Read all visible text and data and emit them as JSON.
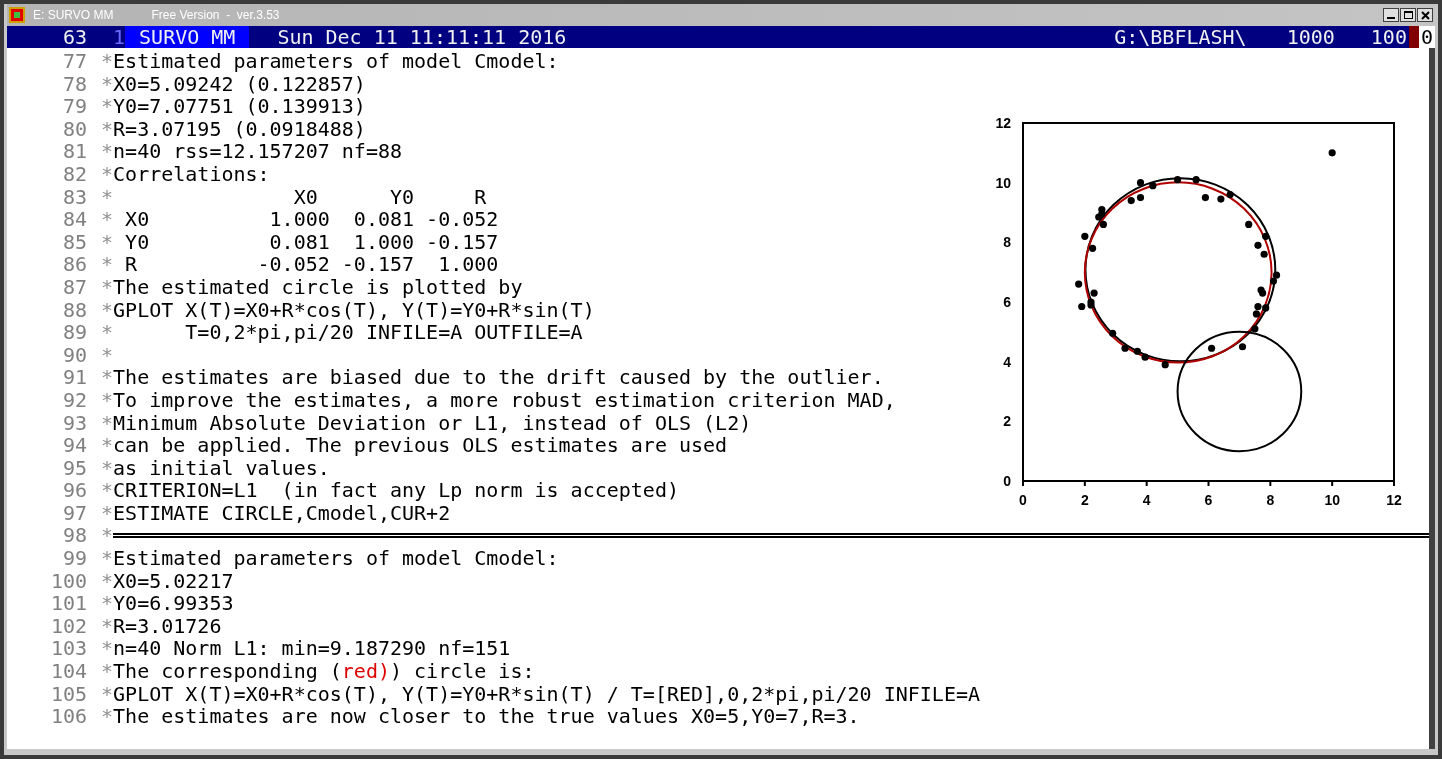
{
  "window": {
    "title": "E: SURVO MM",
    "subtitle": "Free Version  -  ver.3.53"
  },
  "status_bar": {
    "line_count": "63",
    "marker": "1",
    "program": "SURVO MM",
    "datetime": "Sun Dec 11 11:11:11 2016",
    "path": "G:\\BBFLASH\\",
    "value_1": "1000",
    "value_2": "100",
    "column": "0"
  },
  "lines": [
    {
      "num": "77",
      "ctrl": "*",
      "segments": [
        {
          "text": "Estimated parameters of model Cmodel:"
        }
      ]
    },
    {
      "num": "78",
      "ctrl": "*",
      "segments": [
        {
          "text": "X0=5.09242 (0.122857)"
        }
      ]
    },
    {
      "num": "79",
      "ctrl": "*",
      "segments": [
        {
          "text": "Y0=7.07751 (0.139913)"
        }
      ]
    },
    {
      "num": "80",
      "ctrl": "*",
      "segments": [
        {
          "text": "R=3.07195 (0.0918488)"
        }
      ]
    },
    {
      "num": "81",
      "ctrl": "*",
      "segments": [
        {
          "text": "n=40 rss=12.157207 nf=88"
        }
      ]
    },
    {
      "num": "82",
      "ctrl": "*",
      "segments": [
        {
          "text": "Correlations:"
        }
      ]
    },
    {
      "num": "83",
      "ctrl": "*",
      "segments": [
        {
          "text": "               X0      Y0     R"
        }
      ]
    },
    {
      "num": "84",
      "ctrl": "*",
      "segments": [
        {
          "text": " X0          1.000  0.081 -0.052"
        }
      ]
    },
    {
      "num": "85",
      "ctrl": "*",
      "segments": [
        {
          "text": " Y0          0.081  1.000 -0.157"
        }
      ]
    },
    {
      "num": "86",
      "ctrl": "*",
      "segments": [
        {
          "text": " R          -0.052 -0.157  1.000"
        }
      ]
    },
    {
      "num": "87",
      "ctrl": "*",
      "segments": [
        {
          "text": "The estimated circle is plotted by"
        }
      ]
    },
    {
      "num": "88",
      "ctrl": "*",
      "segments": [
        {
          "text": "GPLOT X(T)=X0+R*cos(T), Y(T)=Y0+R*sin(T)"
        }
      ]
    },
    {
      "num": "89",
      "ctrl": "*",
      "segments": [
        {
          "text": "      T=0,2*pi,pi/20 INFILE=A OUTFILE=A"
        }
      ]
    },
    {
      "num": "90",
      "ctrl": "*"
    },
    {
      "num": "91",
      "ctrl": "*",
      "segments": [
        {
          "text": "The estimates are biased due to the drift caused by the outlier."
        }
      ]
    },
    {
      "num": "92",
      "ctrl": "*",
      "segments": [
        {
          "text": "To improve the estimates, a more robust estimation criterion MAD,"
        }
      ]
    },
    {
      "num": "93",
      "ctrl": "*",
      "segments": [
        {
          "text": "Minimum Absolute Deviation or L1, instead of OLS (L2)"
        }
      ]
    },
    {
      "num": "94",
      "ctrl": "*",
      "segments": [
        {
          "text": "can be applied. The previous OLS estimates are used"
        }
      ]
    },
    {
      "num": "95",
      "ctrl": "*",
      "segments": [
        {
          "text": "as initial values."
        }
      ]
    },
    {
      "num": "96",
      "ctrl": "*",
      "segments": [
        {
          "text": "CRITERION=L1  (in fact any Lp norm is accepted)"
        }
      ]
    },
    {
      "num": "97",
      "ctrl": "*",
      "segments": [
        {
          "text": "ESTIMATE CIRCLE,Cmodel,CUR+2"
        }
      ]
    },
    {
      "num": "98",
      "ctrl": "*",
      "kind": "rule"
    },
    {
      "num": "99",
      "ctrl": "*",
      "segments": [
        {
          "text": "Estimated parameters of model Cmodel:"
        }
      ]
    },
    {
      "num": "100",
      "ctrl": "*",
      "segments": [
        {
          "text": "X0=5.02217"
        }
      ]
    },
    {
      "num": "101",
      "ctrl": "*",
      "segments": [
        {
          "text": "Y0=6.99353"
        }
      ]
    },
    {
      "num": "102",
      "ctrl": "*",
      "segments": [
        {
          "text": "R=3.01726"
        }
      ]
    },
    {
      "num": "103",
      "ctrl": "*",
      "segments": [
        {
          "text": "n=40 Norm L1: min=9.187290 nf=151"
        }
      ]
    },
    {
      "num": "104",
      "ctrl": "*",
      "segments": [
        {
          "text": "The corresponding ("
        },
        {
          "text": "red)",
          "color": "#e00000"
        },
        {
          "text": ") circle is:"
        }
      ]
    },
    {
      "num": "105",
      "ctrl": "*",
      "segments": [
        {
          "text": "GPLOT X(T)=X0+R*cos(T), Y(T)=Y0+R*sin(T) / T=[RED],0,2*pi,pi/20 INFILE=A"
        }
      ]
    },
    {
      "num": "106",
      "ctrl": "*",
      "segments": [
        {
          "text": "The estimates are now closer to the true values X0=5,Y0=7,R=3."
        }
      ]
    }
  ],
  "chart": {
    "chart_data": {
      "type": "scatter",
      "xlim": [
        0,
        12
      ],
      "ylim": [
        0,
        12
      ],
      "xticks": [
        0,
        2,
        4,
        6,
        8,
        10,
        12
      ],
      "yticks": [
        0,
        2,
        4,
        6,
        8,
        10,
        12
      ],
      "series": [
        {
          "color": "#000000",
          "x": [
            1.8,
            1.9,
            2.0,
            2.2,
            2.2,
            2.25,
            2.3,
            2.45,
            2.55,
            2.6,
            2.9,
            3.3,
            3.5,
            3.7,
            3.8,
            3.8,
            3.95,
            4.2,
            4.6,
            5.0,
            5.6,
            5.9,
            6.1,
            6.4,
            6.7,
            7.1,
            7.3,
            7.5,
            7.55,
            7.6,
            7.6,
            7.7,
            7.75,
            7.8,
            7.85,
            7.85,
            8.1,
            8.2,
            2.55,
            10.0
          ],
          "values": [
            6.6,
            5.85,
            8.2,
            5.9,
            6.0,
            7.8,
            6.3,
            8.85,
            9.1,
            8.6,
            4.95,
            4.45,
            9.4,
            4.35,
            9.5,
            10.0,
            4.15,
            9.9,
            3.9,
            10.1,
            10.1,
            9.5,
            4.45,
            9.45,
            9.6,
            4.5,
            8.6,
            5.1,
            5.6,
            5.85,
            7.9,
            6.4,
            6.3,
            7.6,
            5.8,
            8.2,
            6.7,
            6.9,
            8.95,
            11.0
          ]
        }
      ]
    },
    "curves": [
      {
        "color": "#000000"
      },
      {
        "color": "#b00000"
      },
      {
        "color": "#000000"
      }
    ]
  }
}
